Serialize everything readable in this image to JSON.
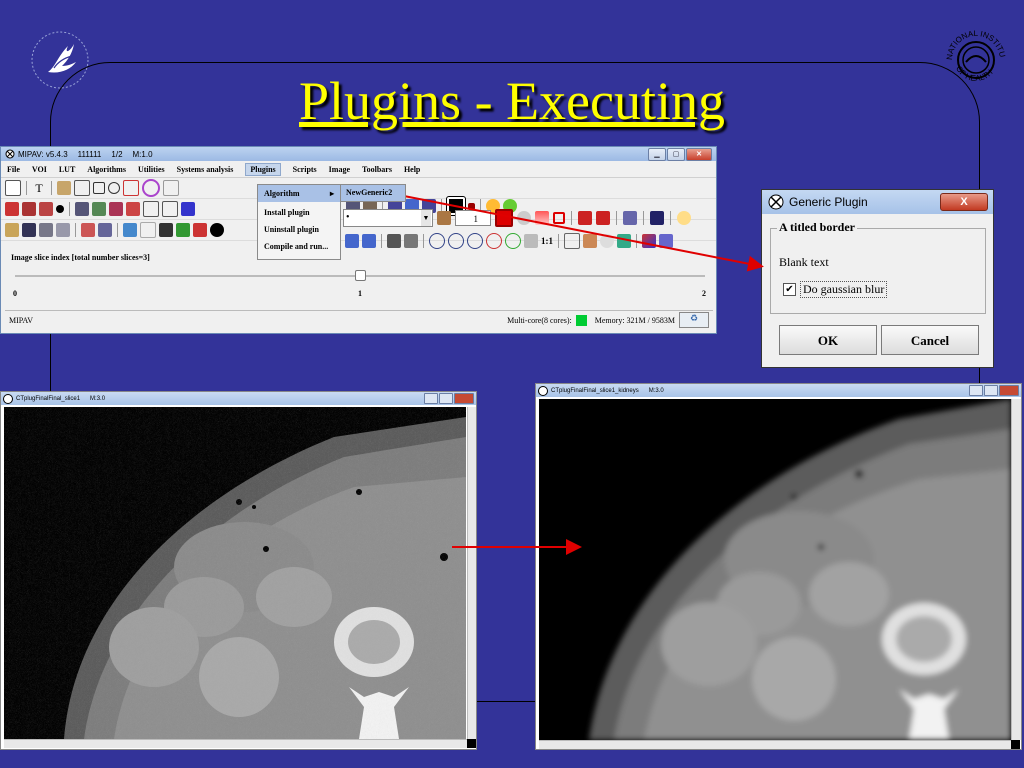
{
  "slide": {
    "title": "Plugins - Executing"
  },
  "logos": {
    "hhs": "hhs-eagle-logo",
    "nih": "nih-seal-logo",
    "nih_text_top": "NATIONAL INSTITUTES",
    "nih_text_bottom": "OF HEALTH"
  },
  "mipav": {
    "title": "MIPAV: v5.4.3",
    "image_name": "111111",
    "slice": "1/2",
    "zoom": "M:1.0",
    "menu": [
      "File",
      "VOI",
      "LUT",
      "Algorithms",
      "Utilities",
      "Systems analysis",
      "Plugins",
      "Scripts",
      "Image",
      "Toolbars",
      "Help"
    ],
    "plugins_menu": {
      "algorithm": "Algorithm",
      "install": "Install plugin",
      "uninstall": "Uninstall plugin",
      "compile": "Compile and run..."
    },
    "submenu_item": "NewGeneric2",
    "toolbar_combo_value": "•",
    "toolbar_spinner_value": "1",
    "zoom_label": "1:1",
    "slider_label": "Image slice index  [total number slices=3]",
    "slider_ticks": [
      "0",
      "1",
      "2"
    ],
    "slider_value": 1,
    "slider_min": 0,
    "slider_max": 2,
    "status_left": "MIPAV",
    "status_cores": "Multi-core(8 cores):",
    "status_memory": "Memory: 321M / 9583M"
  },
  "dialog": {
    "title": "Generic Plugin",
    "close_label": "X",
    "border_title": "A titled border",
    "blank_text": "Blank text",
    "checkbox_label": "Do gaussian blur",
    "checkbox_checked": true,
    "ok_label": "OK",
    "cancel_label": "Cancel"
  },
  "image_windows": [
    {
      "title": "CTplugFinalFinal_slice1",
      "zoom": "M:3.0"
    },
    {
      "title": "CTplugFinalFinal_slice1_kidneys",
      "zoom": "M:3.0"
    }
  ],
  "colors": {
    "background": "#333399",
    "title": "#ffff00",
    "arrow": "#e00000",
    "memory_indicator": "#00cc33"
  }
}
